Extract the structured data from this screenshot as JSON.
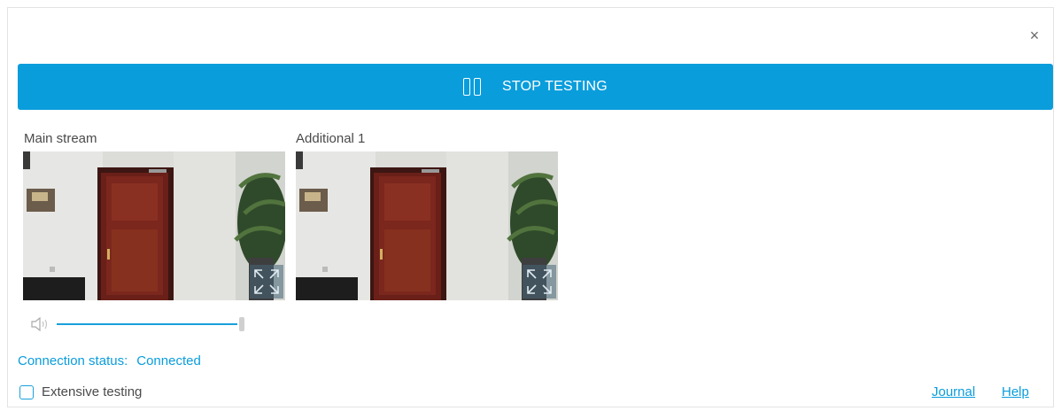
{
  "dialog": {
    "close_symbol": "×",
    "stop_button_label": "STOP TESTING",
    "streams": [
      {
        "title": "Main stream"
      },
      {
        "title": "Additional 1"
      }
    ],
    "volume": {
      "level_fraction": 1.0
    },
    "connection": {
      "label": "Connection status:",
      "value": "Connected"
    },
    "extensive_testing": {
      "label": "Extensive testing",
      "checked": false
    },
    "links": {
      "journal": "Journal",
      "help": "Help"
    },
    "colors": {
      "accent": "#0a9ddb",
      "text": "#4a4a4a"
    },
    "icons": [
      "close-icon",
      "pause-icon",
      "expand-icon",
      "speaker-icon"
    ]
  }
}
